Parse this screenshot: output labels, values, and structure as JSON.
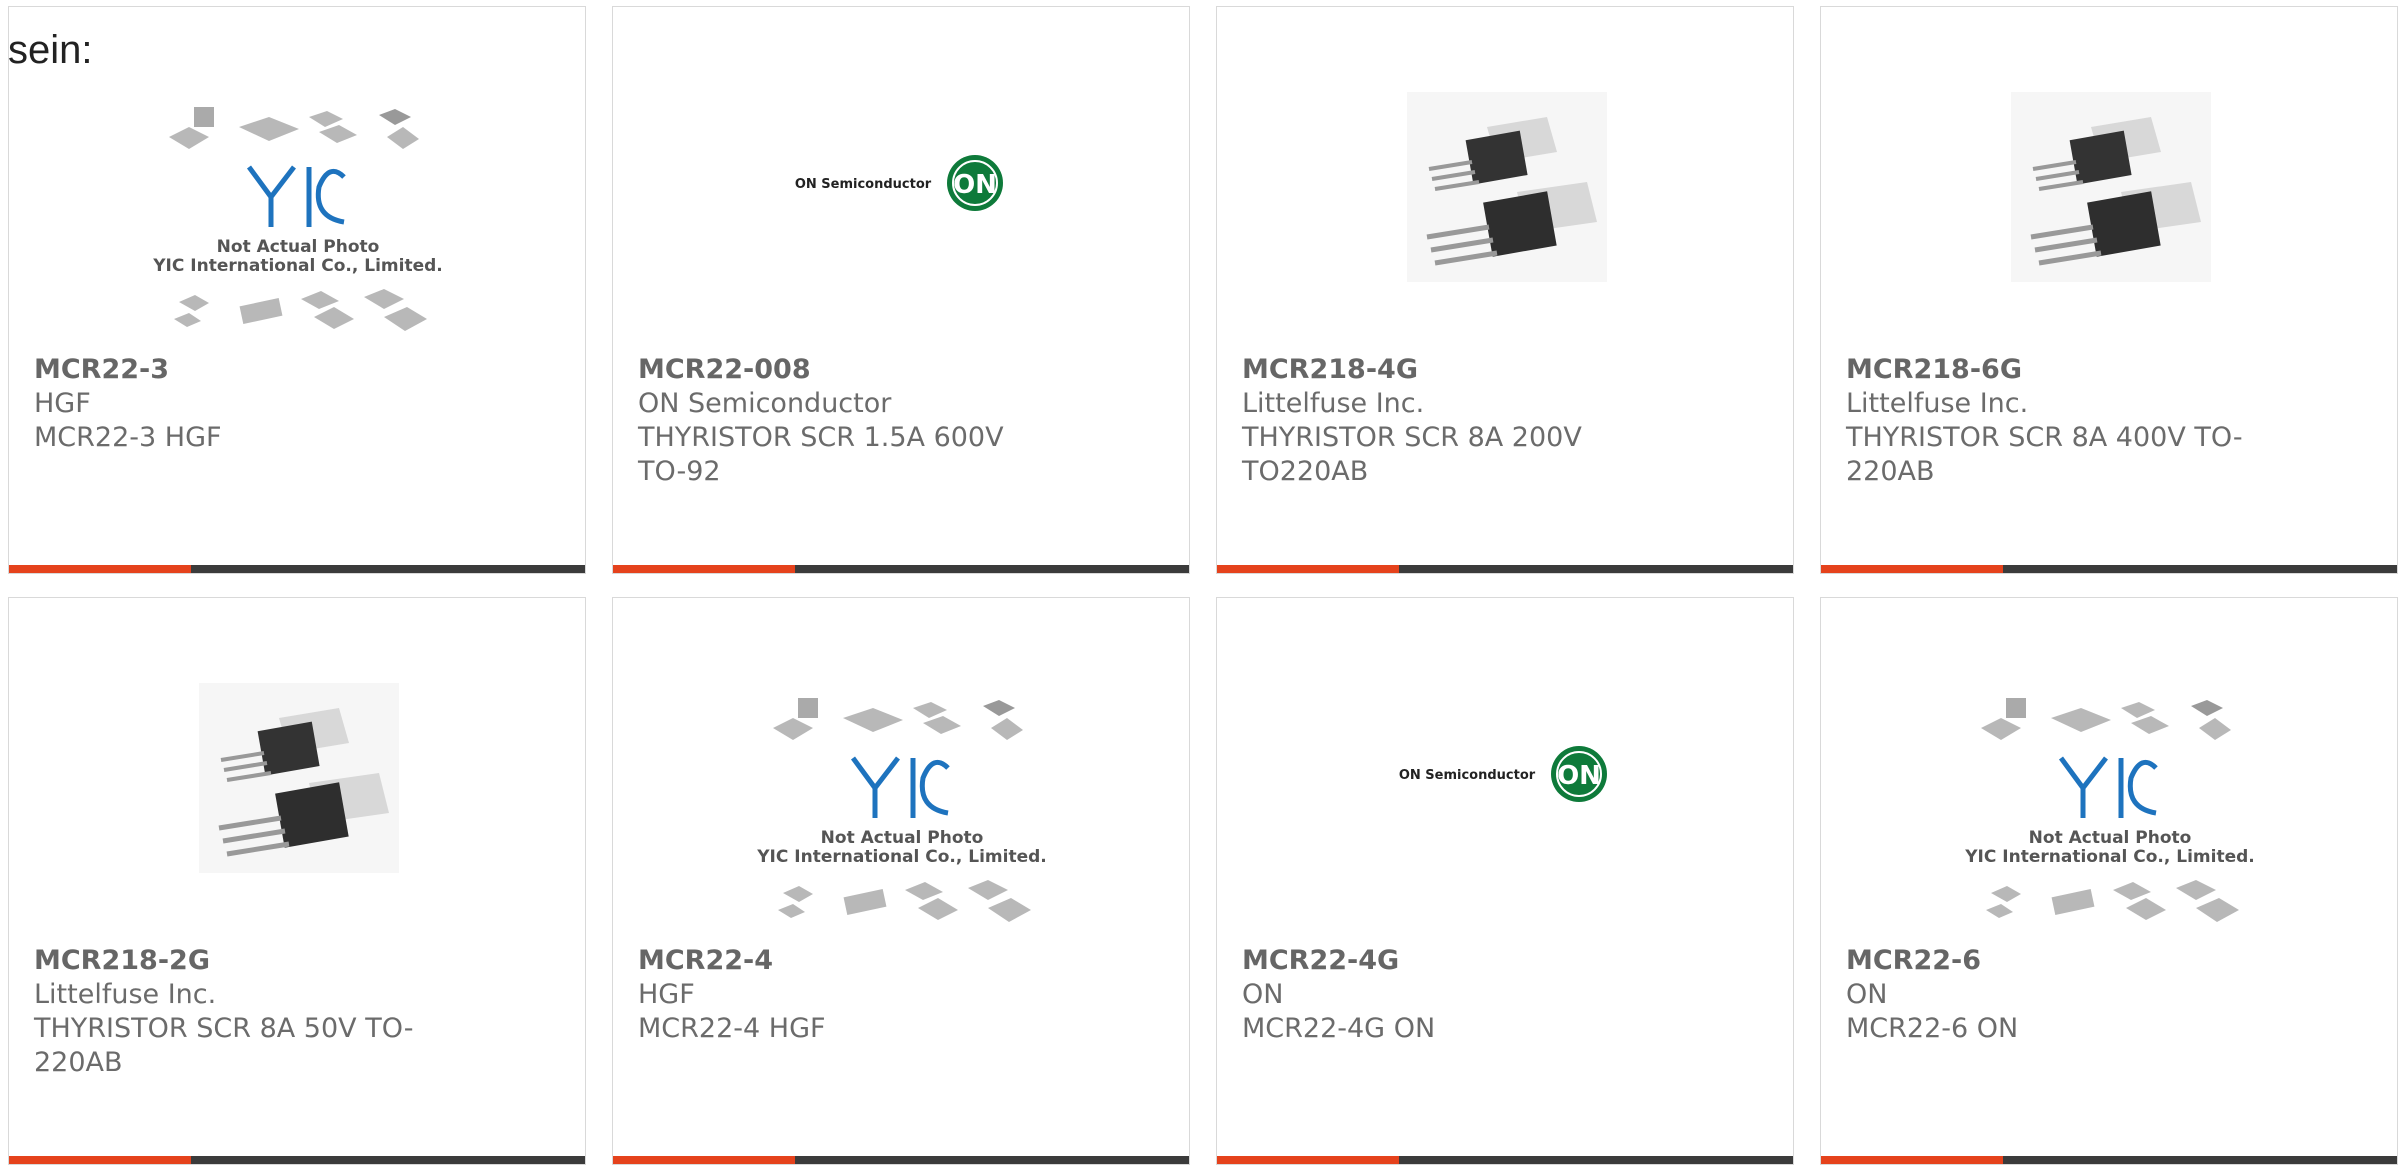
{
  "intro_text": "sein:",
  "colors": {
    "accent": "#e5421c",
    "bar": "#3b3b3b",
    "text": "#6b6b6b",
    "on_logo": "#0e7a3a",
    "yic_logo": "#1e73be"
  },
  "cards": [
    {
      "image": "yic-placeholder",
      "part": "MCR22-3",
      "maker": "HGF",
      "desc": "MCR22-3 HGF",
      "yic_caption1": "Not Actual Photo",
      "yic_caption2": "YIC International Co., Limited."
    },
    {
      "image": "on-semi-logo",
      "part": "MCR22-008",
      "maker": "ON Semiconductor",
      "desc": "THYRISTOR SCR 1.5A 600V TO-92",
      "logo_text": "ON Semiconductor",
      "logo_badge": "ON"
    },
    {
      "image": "to220-photo",
      "part": "MCR218-4G",
      "maker": "Littelfuse Inc.",
      "desc": "THYRISTOR SCR 8A 200V TO220AB"
    },
    {
      "image": "to220-photo",
      "part": "MCR218-6G",
      "maker": "Littelfuse Inc.",
      "desc": "THYRISTOR SCR 8A 400V TO-220AB"
    },
    {
      "image": "to220-photo",
      "part": "MCR218-2G",
      "maker": "Littelfuse Inc.",
      "desc": "THYRISTOR SCR 8A 50V TO-220AB"
    },
    {
      "image": "yic-placeholder",
      "part": "MCR22-4",
      "maker": "HGF",
      "desc": "MCR22-4 HGF",
      "yic_caption1": "Not Actual Photo",
      "yic_caption2": "YIC International Co., Limited."
    },
    {
      "image": "on-semi-logo",
      "part": "MCR22-4G",
      "maker": "ON",
      "desc": "MCR22-4G ON",
      "logo_text": "ON Semiconductor",
      "logo_badge": "ON"
    },
    {
      "image": "yic-placeholder",
      "part": "MCR22-6",
      "maker": "ON",
      "desc": "MCR22-6 ON",
      "yic_caption1": "Not Actual Photo",
      "yic_caption2": "YIC International Co., Limited."
    }
  ]
}
